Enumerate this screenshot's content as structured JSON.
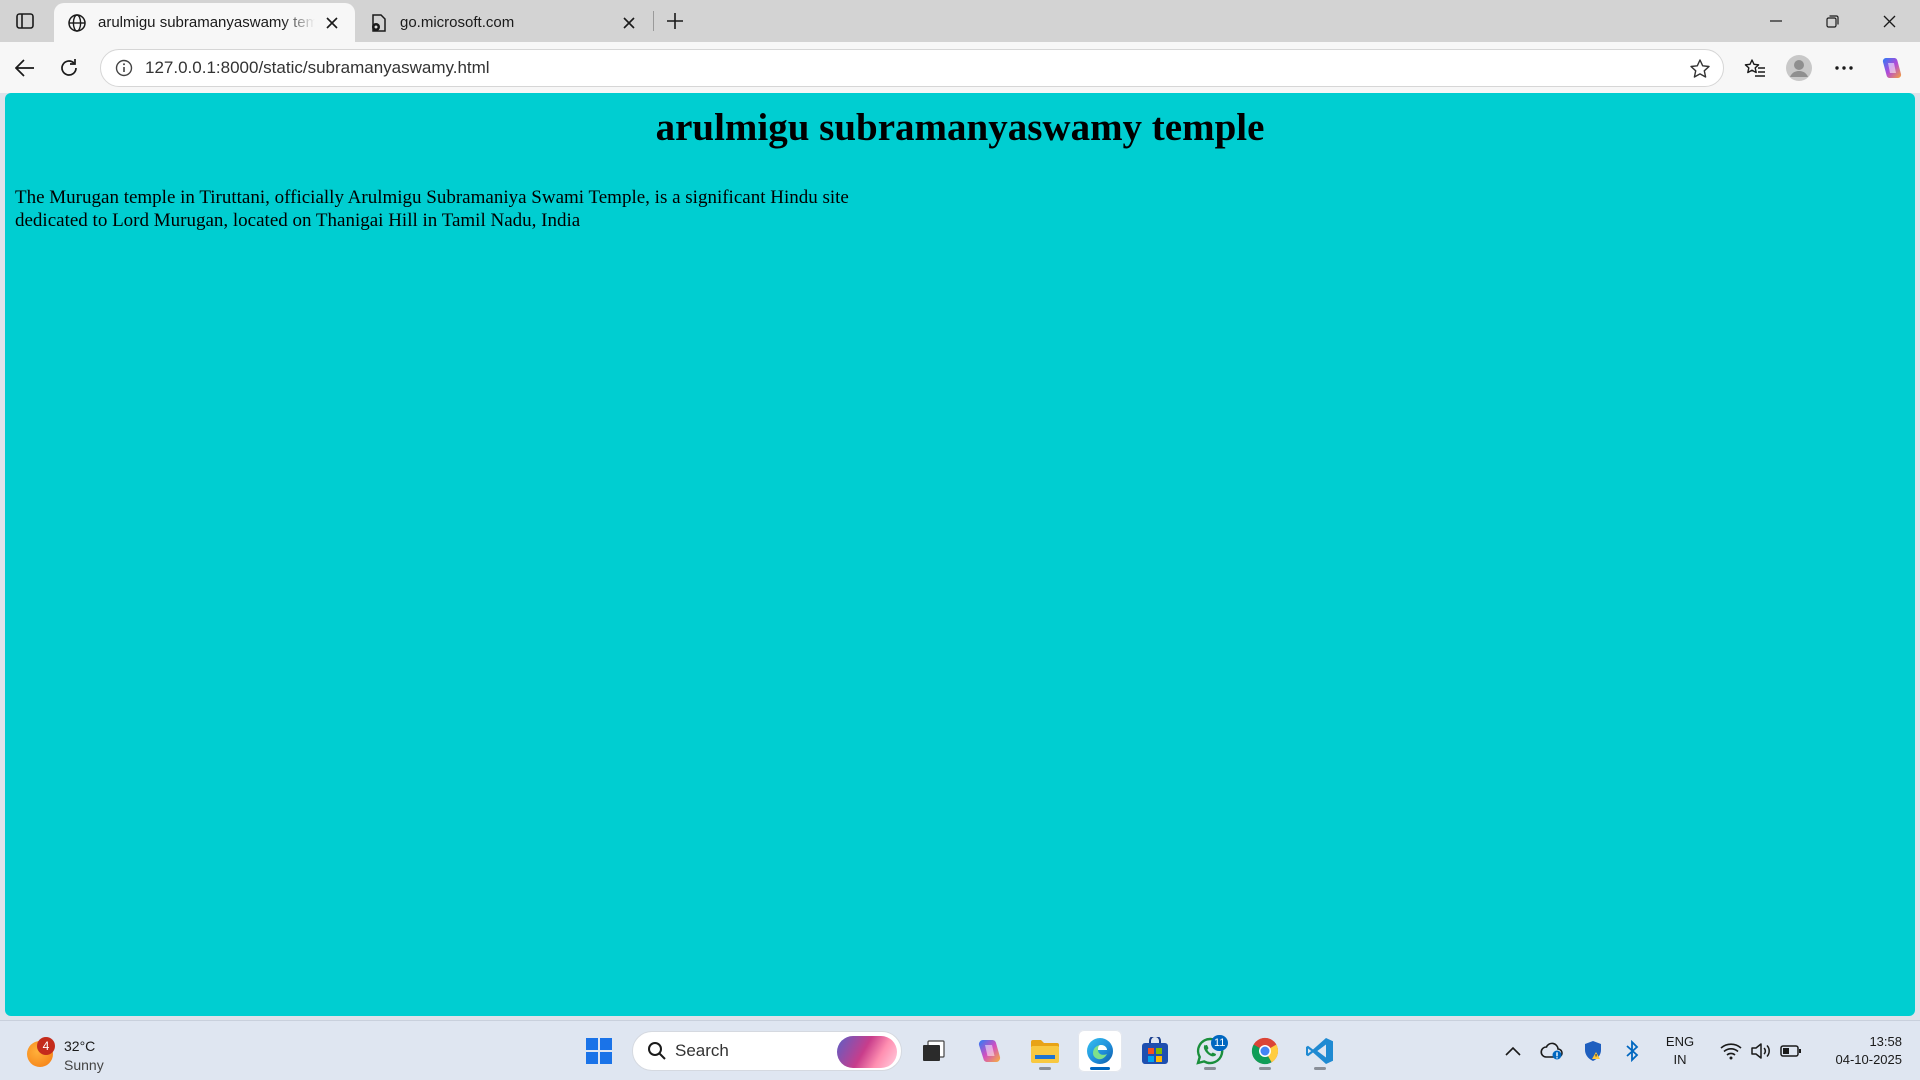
{
  "browser": {
    "tabs": [
      {
        "title": "arulmigu subramanyaswamy temple",
        "active": true,
        "icon": "globe-icon"
      },
      {
        "title": "go.microsoft.com",
        "active": false,
        "icon": "page-icon"
      }
    ],
    "address": {
      "url": "127.0.0.1:8000/static/subramanyaswamy.html"
    }
  },
  "page": {
    "heading": "arulmigu subramanyaswamy temple",
    "paragraph": "The Murugan temple in Tiruttani, officially Arulmigu Subramaniya Swami Temple, is a significant Hindu site dedicated to Lord Murugan, located on Thanigai Hill in Tamil Nadu, India",
    "background_color": "#00ced1"
  },
  "taskbar": {
    "weather": {
      "temperature": "32°C",
      "condition": "Sunny",
      "badge_count": "4"
    },
    "search": {
      "placeholder": "Search"
    },
    "apps": [
      "windows-start",
      "search",
      "task-view",
      "copilot",
      "file-explorer",
      "edge",
      "microsoft-store",
      "whatsapp",
      "chrome",
      "vscode"
    ],
    "whatsapp_badge": "11",
    "language": {
      "line1": "ENG",
      "line2": "IN"
    },
    "clock": {
      "time": "13:58",
      "date": "04-10-2025"
    }
  }
}
